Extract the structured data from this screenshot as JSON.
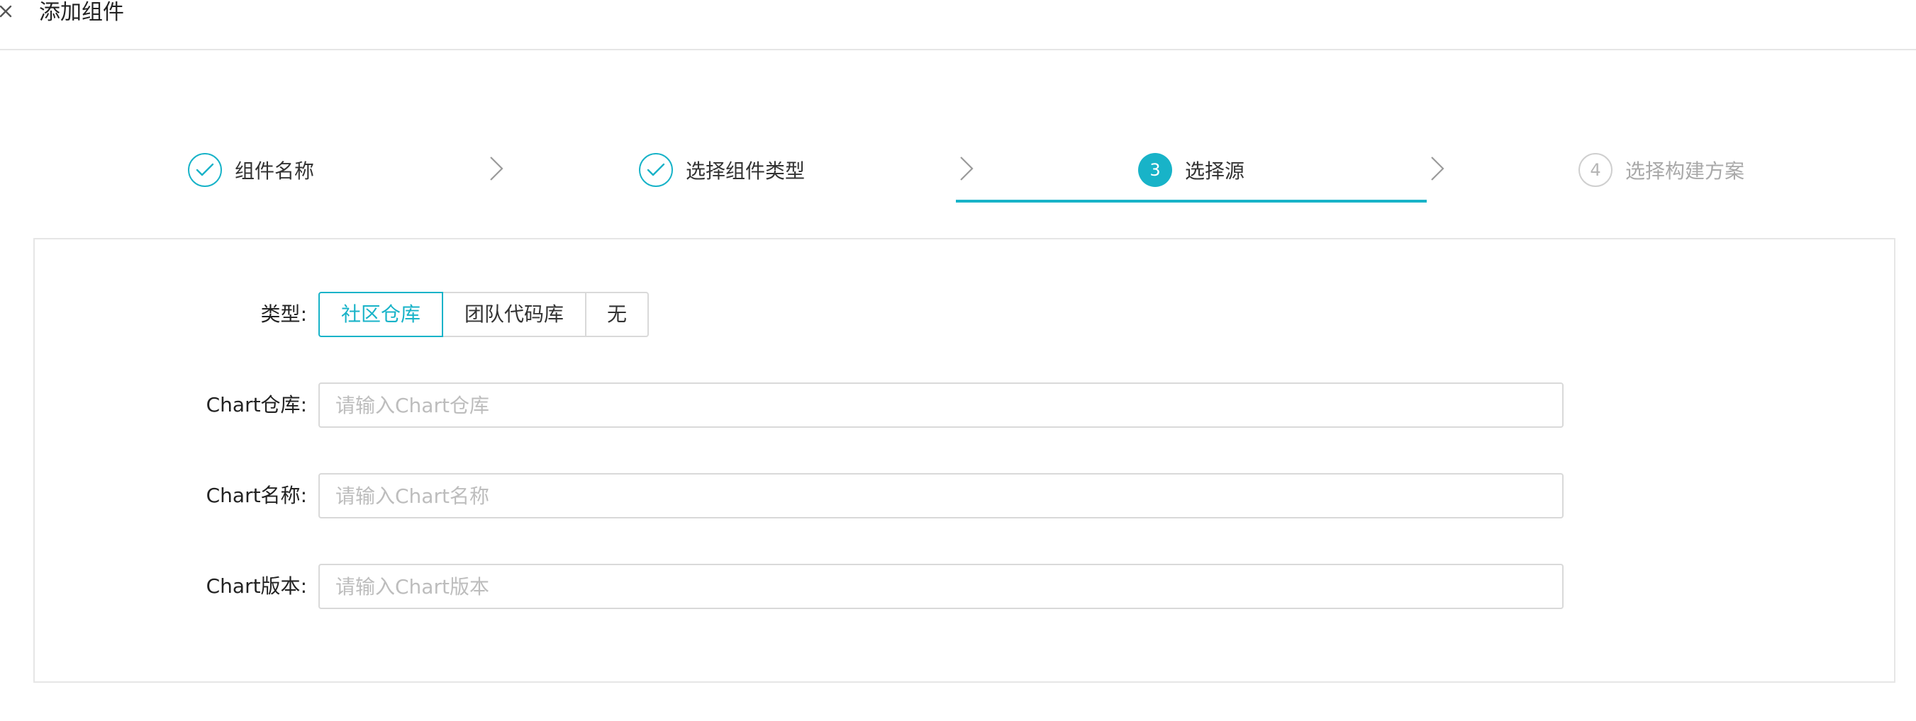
{
  "header": {
    "title": "添加组件",
    "back_icon": "close-icon"
  },
  "steps": [
    {
      "label": "组件名称",
      "status": "done",
      "icon": "check-icon"
    },
    {
      "label": "选择组件类型",
      "status": "done",
      "icon": "check-icon"
    },
    {
      "label": "选择源",
      "status": "active",
      "number": "3"
    },
    {
      "label": "选择构建方案",
      "status": "pending",
      "number": "4"
    }
  ],
  "form": {
    "type_label": "类型",
    "type_options": [
      "社区仓库",
      "团队代码库",
      "无"
    ],
    "type_selected": "社区仓库",
    "repo_label": "Chart仓库",
    "repo_value": "",
    "repo_placeholder": "请输入Chart仓库",
    "name_label": "Chart名称",
    "name_value": "",
    "name_placeholder": "请输入Chart名称",
    "version_label": "Chart版本",
    "version_value": "",
    "version_placeholder": "请输入Chart版本"
  },
  "colors": {
    "accent": "#18b3c8",
    "border": "#d9d9d9",
    "divider": "#e6e6e6",
    "pending": "#a9a9a9"
  }
}
